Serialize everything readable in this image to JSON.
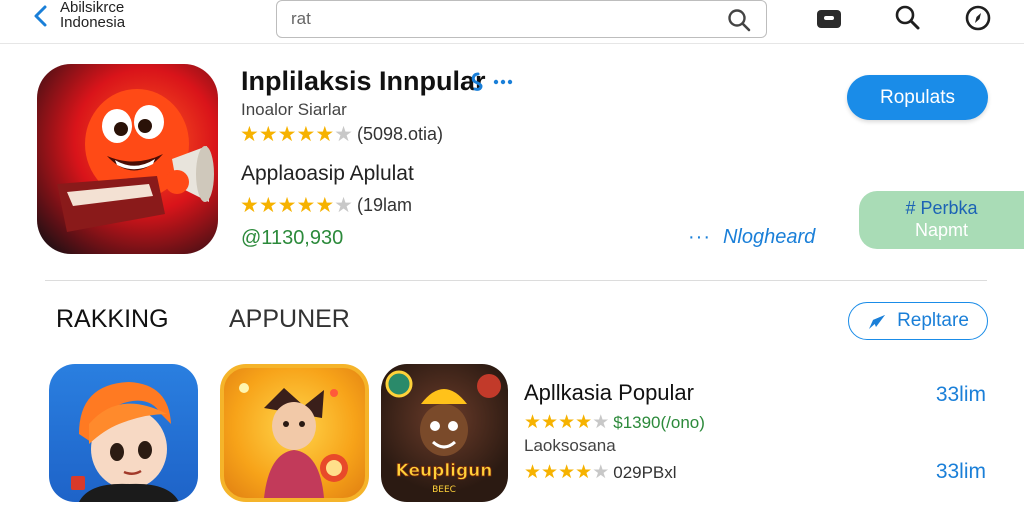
{
  "topbar": {
    "back_line1": "Abilsikrce",
    "back_line2": "Indonesia",
    "search_value": "",
    "search_placeholder": "rat"
  },
  "icons": {
    "back": "chevron-left-icon",
    "search": "search-icon",
    "folder": "folder-icon",
    "search2": "search-icon",
    "compass": "compass-icon",
    "badge": "verified-badge-icon",
    "send": "send-icon"
  },
  "featured": {
    "title": "Inplilaksis Innpular",
    "subtitle": "Inoalor Siarlar",
    "rating_count": "(5098.otia)",
    "rating_stars": 4.5,
    "description": "Applaoasip Aplulat",
    "rating2_count": "(19lam",
    "rating2_stars": 4.5,
    "price": "@1130,930",
    "primary_button": "Ropulats",
    "more_link": "Nlogheard",
    "green_button_line1": "Perbka",
    "green_button_line2": "Napmt"
  },
  "tabs": {
    "tab1": "RAKKING",
    "tab2": "APPUNER"
  },
  "replace_button": "Repltare",
  "list": {
    "app_name": "Apllkasia Popular",
    "rating1_text": "$1390(/ono)",
    "rating1_stars": 4,
    "app_sub": "Laoksosana",
    "rating2_text": "029PBxl",
    "rating2_stars": 4,
    "size1": "33lim",
    "size2": "33lim",
    "icon3_text": "Keupligun",
    "icon3_sub": "BEEC"
  },
  "colors": {
    "accent": "#1a8ce8",
    "star": "#f6b200",
    "price": "#2c8a3b",
    "green_button": "#a9dcb6"
  }
}
